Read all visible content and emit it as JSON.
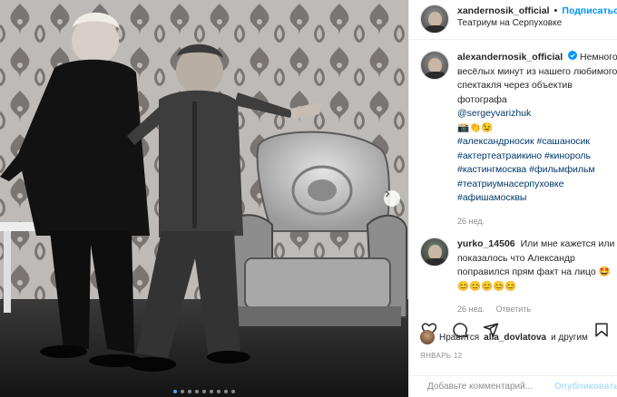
{
  "header": {
    "username": "xandernosik_official",
    "separator": "•",
    "follow_label": "Подписаться",
    "location": "Театриум на Серпуховке"
  },
  "caption": {
    "username": "alexandernosik_official",
    "text": "Немного весёлых минут из нашего любимого спектакля через объектив фотографа",
    "mention": "@sergeyvarizhuk",
    "emojis": "📸👏😉",
    "hashtags": [
      "#александрносик #сашаносик",
      "#актертеатраикино #кинороль",
      "#кастингмосква #фильмфильм",
      "#театриумнасерпуховке",
      "#афишамосквы"
    ],
    "time": "26 нед."
  },
  "comments": [
    {
      "username": "yurko_14506",
      "text": "Или мне кажется или показалось что Александр поправился прям факт на лицо 🤩",
      "emojis": "😊😊😊😊😊",
      "time": "26 нед.",
      "reply_label": "Ответить"
    }
  ],
  "likes": {
    "prefix": "Нравится",
    "user": "alla_dovlatova",
    "suffix": "и другим"
  },
  "date": "ЯНВАРЬ 12",
  "add_comment": {
    "placeholder": "Добавьте комментарий...",
    "publish_label": "Опубликовать"
  },
  "carousel": {
    "count": 9,
    "active_index": 0
  },
  "colors": {
    "link": "#00376b",
    "accent": "#0095f6",
    "muted": "#8e8e8e"
  },
  "icons": [
    "heart-icon",
    "comment-icon",
    "share-icon",
    "bookmark-icon",
    "verified-icon",
    "chevron-right-icon",
    "emoji-icon"
  ]
}
